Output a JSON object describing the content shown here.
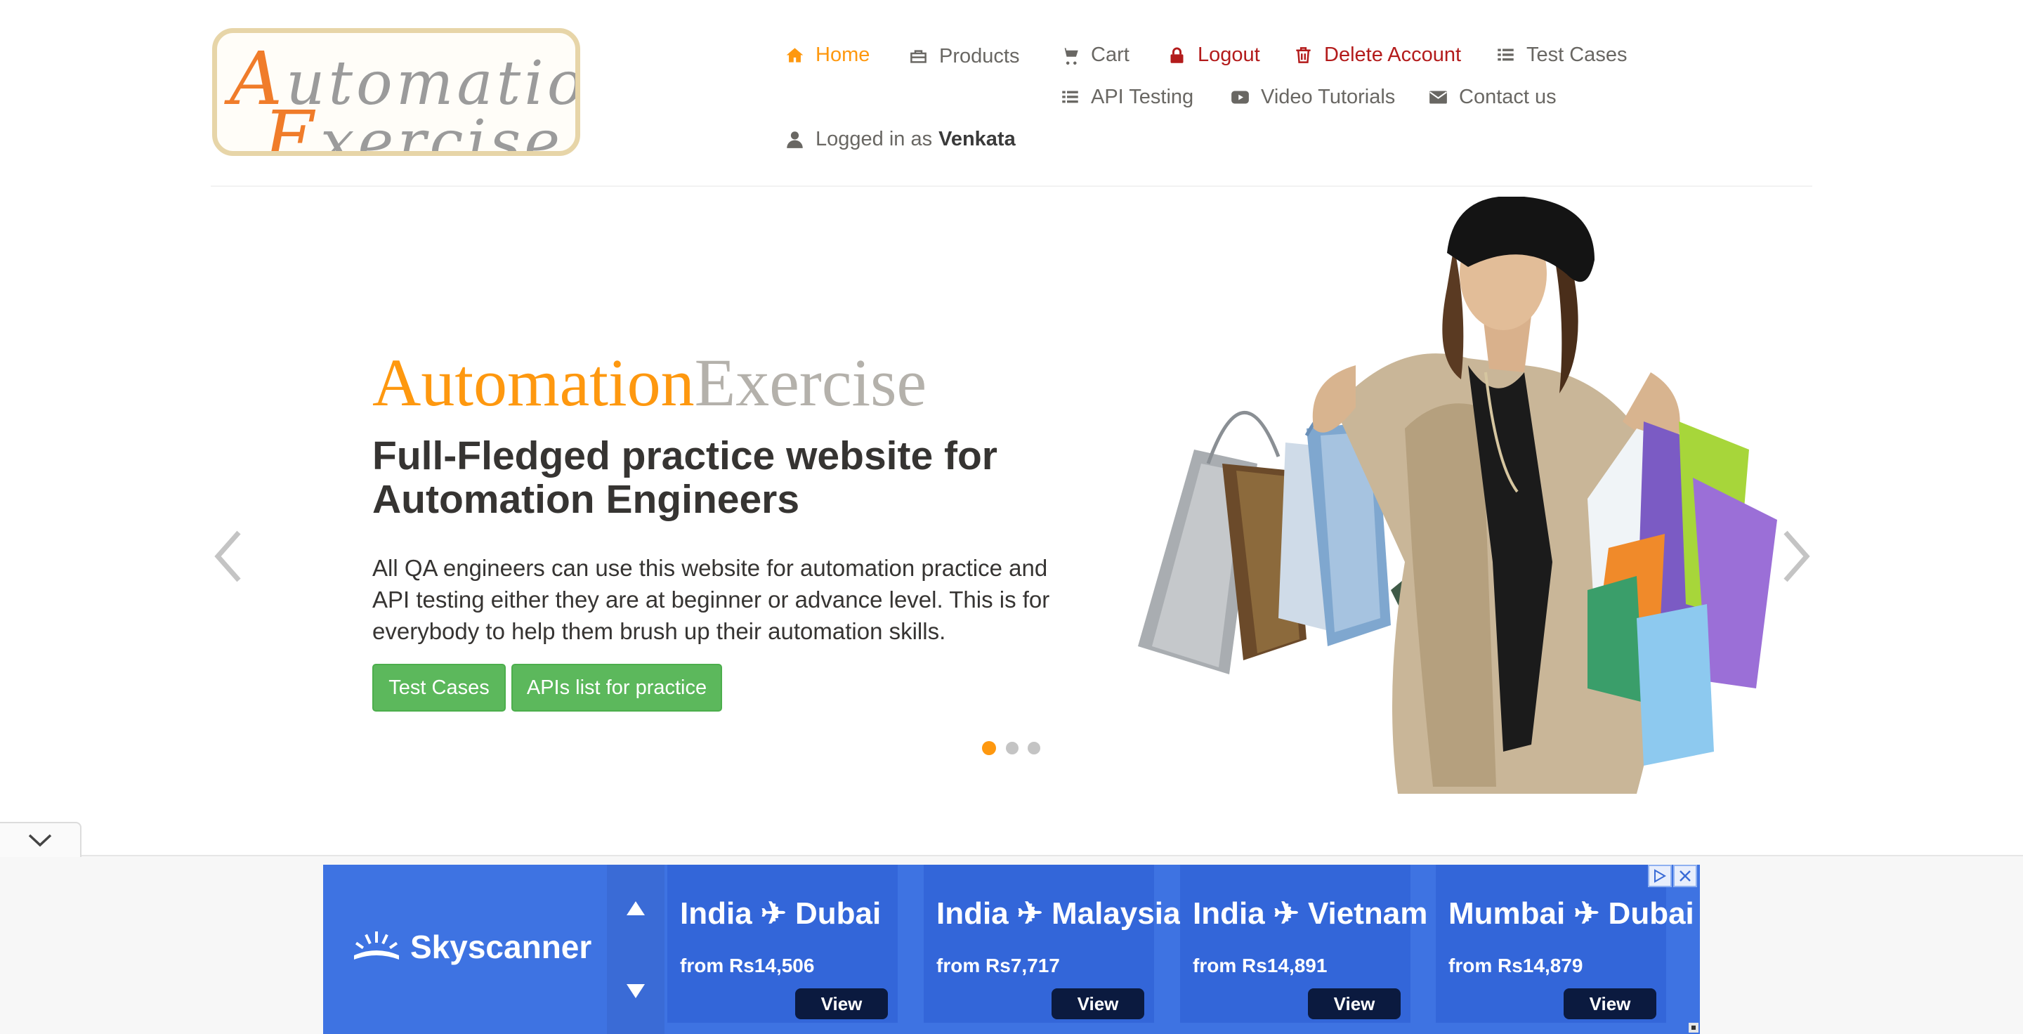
{
  "logo": {
    "line1_first": "A",
    "line1_rest": "utomation",
    "line2_first": "E",
    "line2_rest": "xercise"
  },
  "nav": {
    "home": "Home",
    "products": "Products",
    "cart": "Cart",
    "logout": "Logout",
    "delete_account": "Delete Account",
    "test_cases": "Test Cases",
    "api_testing": "API Testing",
    "video_tutorials": "Video Tutorials",
    "contact_us": "Contact us",
    "logged_in_prefix": "Logged in as",
    "logged_in_user": "Venkata"
  },
  "slider": {
    "brand_part1": "Automation",
    "brand_part2": "Exercise",
    "headline": "Full-Fledged practice website for Automation Engineers",
    "description": "All QA engineers can use this website for automation practice and API testing either they are at beginner or advance level. This is for everybody to help them brush up their automation skills.",
    "btn_test_cases": "Test Cases",
    "btn_apis": "APIs list for practice",
    "active_dot": 1,
    "dot_count": 3
  },
  "ad": {
    "brand": "Skyscanner",
    "cards": [
      {
        "route": "India ✈ Dubai",
        "price": "from Rs14,506",
        "cta": "View"
      },
      {
        "route": "India ✈ Malaysia",
        "price": "from Rs7,717",
        "cta": "View"
      },
      {
        "route": "India ✈ Vietnam",
        "price": "from Rs14,891",
        "cta": "View"
      },
      {
        "route": "Mumbai ✈ Dubai",
        "price": "from Rs14,879",
        "cta": "View"
      }
    ]
  },
  "colors": {
    "accent": "#FE980F",
    "danger": "#b31b1b",
    "button_green": "#5cb85c",
    "ad_blue": "#3e73e2",
    "ad_card_blue": "#3366d9",
    "ad_button_dark": "#0b1a3f"
  },
  "icons": {
    "home": "home-icon",
    "products": "briefcase-icon",
    "cart": "shopping-cart-icon",
    "logout": "lock-icon",
    "delete": "trash-icon",
    "test_cases": "list-icon",
    "api_testing": "list-icon",
    "video": "youtube-play-icon",
    "contact": "envelope-icon",
    "user": "user-icon"
  }
}
